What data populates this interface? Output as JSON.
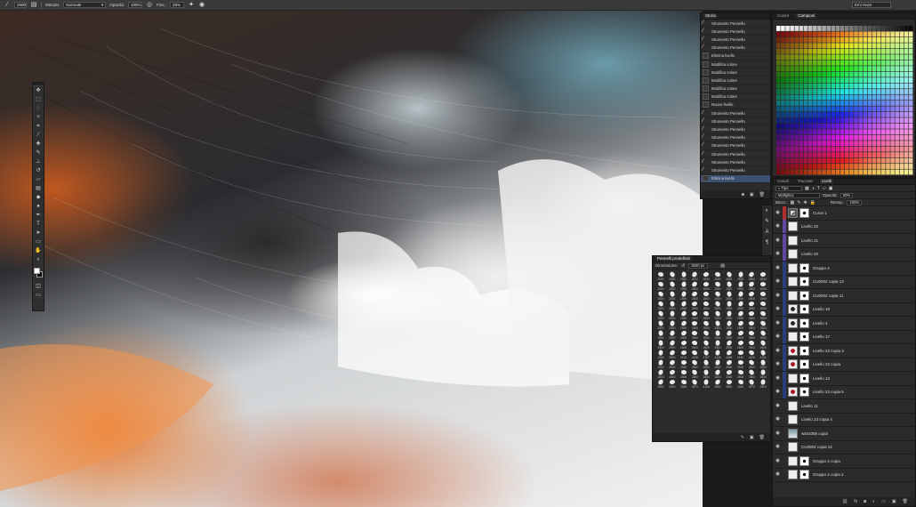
{
  "options_bar": {
    "brush_size": "2500",
    "mode_label": "Metodo:",
    "mode_value": "Normale",
    "opacity_label": "Opacità:",
    "opacity_value": "100%",
    "flow_label": "Flus.:",
    "flow_value": "25%",
    "workspace": "Emi Haze"
  },
  "tools": [
    "move-icon",
    "marquee-icon",
    "lasso-icon",
    "quick-select-icon",
    "crop-icon",
    "eyedropper-icon",
    "healing-icon",
    "brush-icon",
    "stamp-icon",
    "history-brush-icon",
    "eraser-icon",
    "gradient-icon",
    "blur-icon",
    "dodge-icon",
    "pen-icon",
    "type-icon",
    "path-select-icon",
    "shape-icon",
    "hand-icon",
    "zoom-icon"
  ],
  "history": {
    "tab": "Storia",
    "items": [
      {
        "label": "Strumento Pennello",
        "kind": "brush"
      },
      {
        "label": "Strumento Pennello",
        "kind": "brush"
      },
      {
        "label": "Strumento Pennello",
        "kind": "brush"
      },
      {
        "label": "Strumento Pennello",
        "kind": "brush"
      },
      {
        "label": "Elimina livello",
        "kind": "doc"
      },
      {
        "label": "Modifica colore",
        "kind": "doc"
      },
      {
        "label": "Modifica colore",
        "kind": "doc"
      },
      {
        "label": "Modifica colore",
        "kind": "doc"
      },
      {
        "label": "Modifica colore",
        "kind": "doc"
      },
      {
        "label": "Modifica colore",
        "kind": "doc"
      },
      {
        "label": "Nuovo livello",
        "kind": "doc"
      },
      {
        "label": "Strumento Pennello",
        "kind": "brush"
      },
      {
        "label": "Strumento Pennello",
        "kind": "brush"
      },
      {
        "label": "Strumento Pennello",
        "kind": "brush"
      },
      {
        "label": "Strumento Pennello",
        "kind": "brush"
      },
      {
        "label": "Strumento Pennello",
        "kind": "brush"
      },
      {
        "label": "Strumento Pennello",
        "kind": "brush"
      },
      {
        "label": "Strumento Pennello",
        "kind": "brush"
      },
      {
        "label": "Strumento Pennello",
        "kind": "brush"
      },
      {
        "label": "Elimina livello",
        "kind": "doc",
        "selected": true
      }
    ]
  },
  "swatches": {
    "tabs": [
      "Colore",
      "Campioni"
    ]
  },
  "layers_panel": {
    "tabs": [
      "Canali",
      "Tracciati",
      "Livelli"
    ],
    "filter": "Tipo",
    "blend_mode": "Moltiplica",
    "opacity_label": "Opacità:",
    "opacity_value": "50%",
    "lock_label": "Blocc.:",
    "fill_label": "Riemp.:",
    "fill_value": "100%",
    "layers": [
      {
        "name": "Curve 1",
        "tag": "#b03030",
        "thumb": "adjust",
        "mask": true
      },
      {
        "name": "Livello 22",
        "tag": "#5d4aa0",
        "thumb": "blank",
        "mask": false
      },
      {
        "name": "Livello 21",
        "tag": "#5d4aa0",
        "thumb": "blank",
        "mask": false
      },
      {
        "name": "Livello 20",
        "tag": "#5d4aa0",
        "thumb": "blank",
        "mask": false
      },
      {
        "name": "Gruppo 4",
        "tag": "#2a3f7a",
        "thumb": "blank",
        "mask": true
      },
      {
        "name": "CU0002 copia 13",
        "tag": "#2a3f7a",
        "thumb": "blank",
        "mask": true
      },
      {
        "name": "CU0002 copia 11",
        "tag": "#2a3f7a",
        "thumb": "blank",
        "mask": true
      },
      {
        "name": "Livello 18",
        "tag": "#2a3f7a",
        "thumb": "dark",
        "mask": true
      },
      {
        "name": "Livello 4",
        "tag": "#2a3f7a",
        "thumb": "dark",
        "mask": true
      },
      {
        "name": "Livello 17",
        "tag": "#2a3f7a",
        "thumb": "blank",
        "mask": true
      },
      {
        "name": "Livello 23 copia 3",
        "tag": "#2a3f7a",
        "thumb": "red",
        "mask": true
      },
      {
        "name": "Livello 23 copia",
        "tag": "#2a3f7a",
        "thumb": "red",
        "mask": true
      },
      {
        "name": "Livello 12",
        "tag": "#2a3f7a",
        "thumb": "blank",
        "mask": true
      },
      {
        "name": "Livello 23 copia 5",
        "tag": "#2a3f7a",
        "thumb": "red",
        "mask": true
      },
      {
        "name": "Livello 11",
        "tag": "#2b2b2b",
        "thumb": "blank",
        "mask": false
      },
      {
        "name": "Livello 23 copia 4",
        "tag": "#2b2b2b",
        "thumb": "blank",
        "mask": false
      },
      {
        "name": "ws01058 copia",
        "tag": "#2b2b2b",
        "thumb": "photo",
        "mask": false
      },
      {
        "name": "CU0002 copia 12",
        "tag": "#2b2b2b",
        "thumb": "blank",
        "mask": false
      },
      {
        "name": "Gruppo 4 copia",
        "tag": "#2b2b2b",
        "thumb": "blank",
        "mask": true
      },
      {
        "name": "Gruppo 4 copia 2",
        "tag": "#2b2b2b",
        "thumb": "blank",
        "mask": true
      }
    ]
  },
  "brush_presets": {
    "title": "Pennelli predefiniti",
    "size_label": "Dimensione:",
    "size_value": "2500 px",
    "sizes": [
      "2500",
      "2500",
      "2500",
      "4572",
      "2500",
      "2500",
      "2500",
      "2500",
      "2500",
      "2500",
      "2500",
      "2500",
      "2500",
      "2500",
      "2500",
      "2500",
      "2500",
      "2500",
      "2500",
      "2500",
      "2500",
      "2500",
      "2500",
      "2500",
      "2500",
      "2500",
      "2500",
      "2500",
      "2500",
      "2500",
      "2500",
      "2500",
      "2500",
      "2500",
      "2500",
      "2500",
      "2500",
      "2500",
      "2500",
      "2500",
      "2500",
      "2500",
      "2500",
      "2500",
      "2500",
      "2500",
      "2500",
      "2500",
      "2500",
      "2500",
      "2500",
      "2500",
      "2500",
      "2500",
      "2500",
      "2500",
      "2500",
      "2500",
      "2500",
      "2500",
      "2500",
      "2500",
      "2500",
      "2500",
      "2500",
      "2500",
      "2500",
      "2500",
      "2500",
      "2500",
      "2500",
      "2500",
      "2500",
      "2500",
      "2500",
      "2500",
      "2500",
      "2500",
      "2500",
      "2500",
      "1500",
      "3500",
      "4132",
      "4126",
      "4157",
      "4136",
      "4466",
      "4140",
      "4126",
      "4131",
      "2500",
      "2500",
      "2500",
      "2500",
      "2500",
      "2500",
      "2500",
      "2500",
      "2500",
      "2500",
      "2500",
      "2500",
      "2500",
      "2500",
      "2500",
      "2500",
      "2500",
      "2500",
      "2500",
      "2500",
      "2500",
      "2500",
      "2500",
      "3471",
      "4136",
      "2500",
      "4981",
      "4300",
      "4572",
      "2500"
    ]
  }
}
